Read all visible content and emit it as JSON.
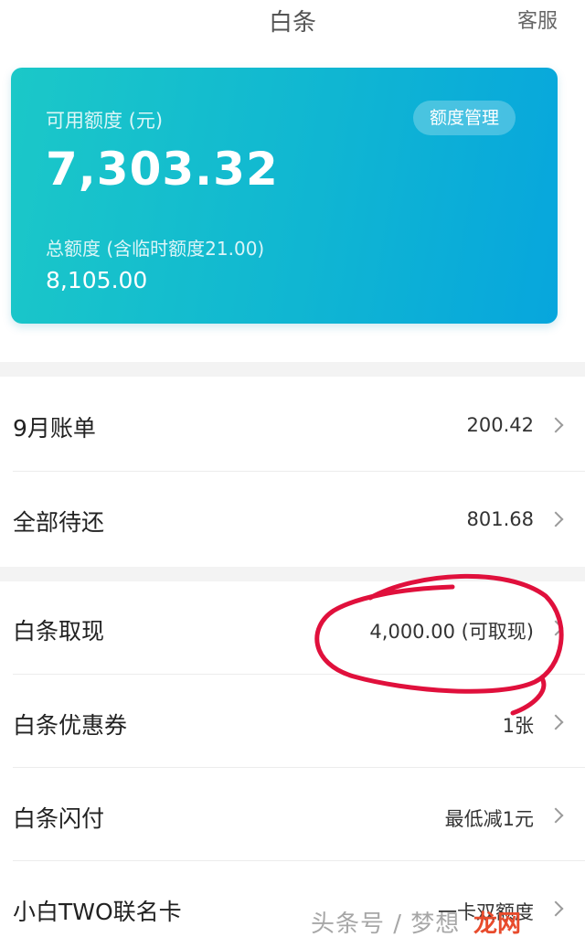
{
  "header": {
    "title": "白条",
    "service": "客服"
  },
  "card": {
    "available_label": "可用额度 (元)",
    "available_amount": "7,303.32",
    "manage_button": "额度管理",
    "total_label": "总额度 (含临时额度21.00)",
    "total_amount": "8,105.00",
    "gradient_start": "#1bc8c8",
    "gradient_end": "#07a6dd"
  },
  "rows": [
    {
      "label": "9月账单",
      "value": "200.42"
    },
    {
      "label": "全部待还",
      "value": "801.68"
    },
    {
      "label": "白条取现",
      "value": "4,000.00 (可取现)"
    },
    {
      "label": "白条优惠券",
      "value": "1张"
    },
    {
      "label": "白条闪付",
      "value": "最低减1元"
    },
    {
      "label": "小白TWO联名卡",
      "value": "一卡双额度"
    }
  ],
  "annotation_color": "#e0103c",
  "watermark": {
    "text": "头条号 / 梦想",
    "brand": "龙网"
  }
}
